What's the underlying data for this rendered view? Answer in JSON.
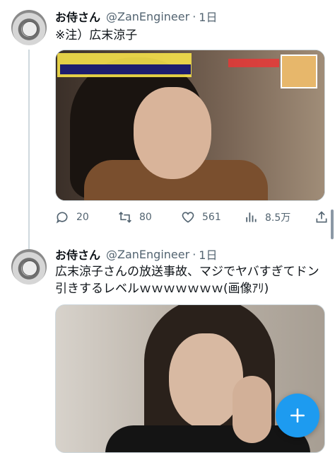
{
  "tweets": [
    {
      "display_name": "お侍さん",
      "handle": "@ZanEngineer",
      "separator": "·",
      "time": "1日",
      "text": "※注）広末涼子",
      "stats": {
        "replies": "20",
        "retweets": "80",
        "likes": "561",
        "views": "8.5万"
      }
    },
    {
      "display_name": "お侍さん",
      "handle": "@ZanEngineer",
      "separator": "·",
      "time": "1日",
      "text": "広末涼子さんの放送事故、マジでヤバすぎてドン引きするレベルｗｗｗｗｗｗｗ(画像ｱﾘ)"
    }
  ],
  "fab": {
    "icon": "plus-icon"
  },
  "colors": {
    "accent": "#1d9bf0",
    "secondary_text": "#536471",
    "primary_text": "#0f1419",
    "line": "#cfd9de"
  }
}
